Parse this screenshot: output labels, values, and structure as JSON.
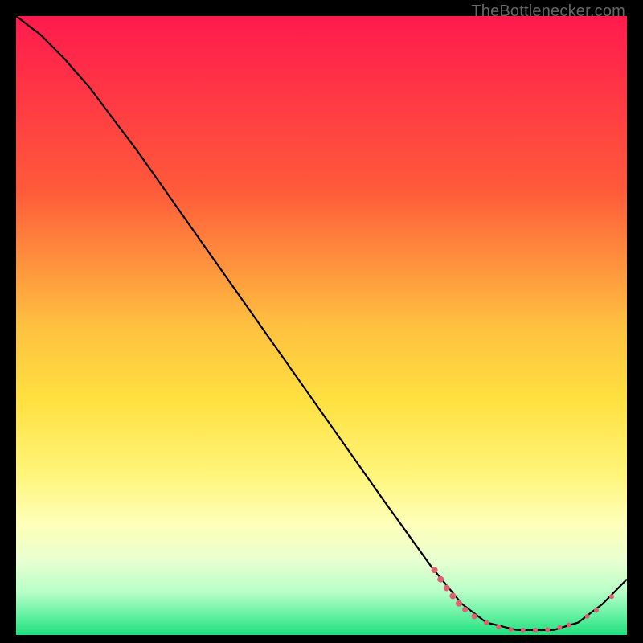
{
  "watermark": "TheBottlenecker.com",
  "chart_data": {
    "type": "line",
    "title": "",
    "xlabel": "",
    "ylabel": "",
    "xlim": [
      0,
      100
    ],
    "ylim": [
      0,
      100
    ],
    "gradient_stops": [
      {
        "offset": 0,
        "color": "#ff1a4d"
      },
      {
        "offset": 28,
        "color": "#ff5a3a"
      },
      {
        "offset": 50,
        "color": "#ffc040"
      },
      {
        "offset": 62,
        "color": "#ffe040"
      },
      {
        "offset": 74,
        "color": "#fff57a"
      },
      {
        "offset": 82,
        "color": "#feffb8"
      },
      {
        "offset": 88,
        "color": "#e8ffd0"
      },
      {
        "offset": 93,
        "color": "#b8ffc8"
      },
      {
        "offset": 97,
        "color": "#60f0a0"
      },
      {
        "offset": 100,
        "color": "#20e080"
      }
    ],
    "series": [
      {
        "name": "curve",
        "color": "#000000",
        "points": [
          {
            "x": 0,
            "y": 100
          },
          {
            "x": 4,
            "y": 97
          },
          {
            "x": 8,
            "y": 93
          },
          {
            "x": 12,
            "y": 88.5
          },
          {
            "x": 20,
            "y": 78
          },
          {
            "x": 30,
            "y": 64
          },
          {
            "x": 40,
            "y": 50
          },
          {
            "x": 50,
            "y": 36
          },
          {
            "x": 60,
            "y": 22
          },
          {
            "x": 68,
            "y": 11
          },
          {
            "x": 73,
            "y": 5
          },
          {
            "x": 77,
            "y": 2
          },
          {
            "x": 82,
            "y": 0.8
          },
          {
            "x": 88,
            "y": 0.8
          },
          {
            "x": 92,
            "y": 2
          },
          {
            "x": 96,
            "y": 5
          },
          {
            "x": 100,
            "y": 9
          }
        ]
      }
    ],
    "markers": {
      "color": "#e06070",
      "points": [
        {
          "x": 68.5,
          "y": 10.5,
          "r": 4.0
        },
        {
          "x": 69.5,
          "y": 9.0,
          "r": 4.0
        },
        {
          "x": 70.5,
          "y": 7.6,
          "r": 4.0
        },
        {
          "x": 71.5,
          "y": 6.3,
          "r": 4.0
        },
        {
          "x": 72.5,
          "y": 5.1,
          "r": 4.0
        },
        {
          "x": 73.5,
          "y": 4.1,
          "r": 3.5
        },
        {
          "x": 75.0,
          "y": 3.0,
          "r": 3.5
        },
        {
          "x": 77.0,
          "y": 2.0,
          "r": 3.0
        },
        {
          "x": 79.0,
          "y": 1.3,
          "r": 3.0
        },
        {
          "x": 81.0,
          "y": 0.9,
          "r": 3.0
        },
        {
          "x": 83.0,
          "y": 0.8,
          "r": 3.0
        },
        {
          "x": 85.0,
          "y": 0.8,
          "r": 3.0
        },
        {
          "x": 87.0,
          "y": 0.9,
          "r": 3.0
        },
        {
          "x": 89.0,
          "y": 1.2,
          "r": 3.0
        },
        {
          "x": 90.5,
          "y": 1.6,
          "r": 3.0
        },
        {
          "x": 93.5,
          "y": 3.0,
          "r": 3.0
        },
        {
          "x": 95.0,
          "y": 4.0,
          "r": 3.0
        },
        {
          "x": 97.5,
          "y": 6.2,
          "r": 3.0
        }
      ]
    }
  }
}
